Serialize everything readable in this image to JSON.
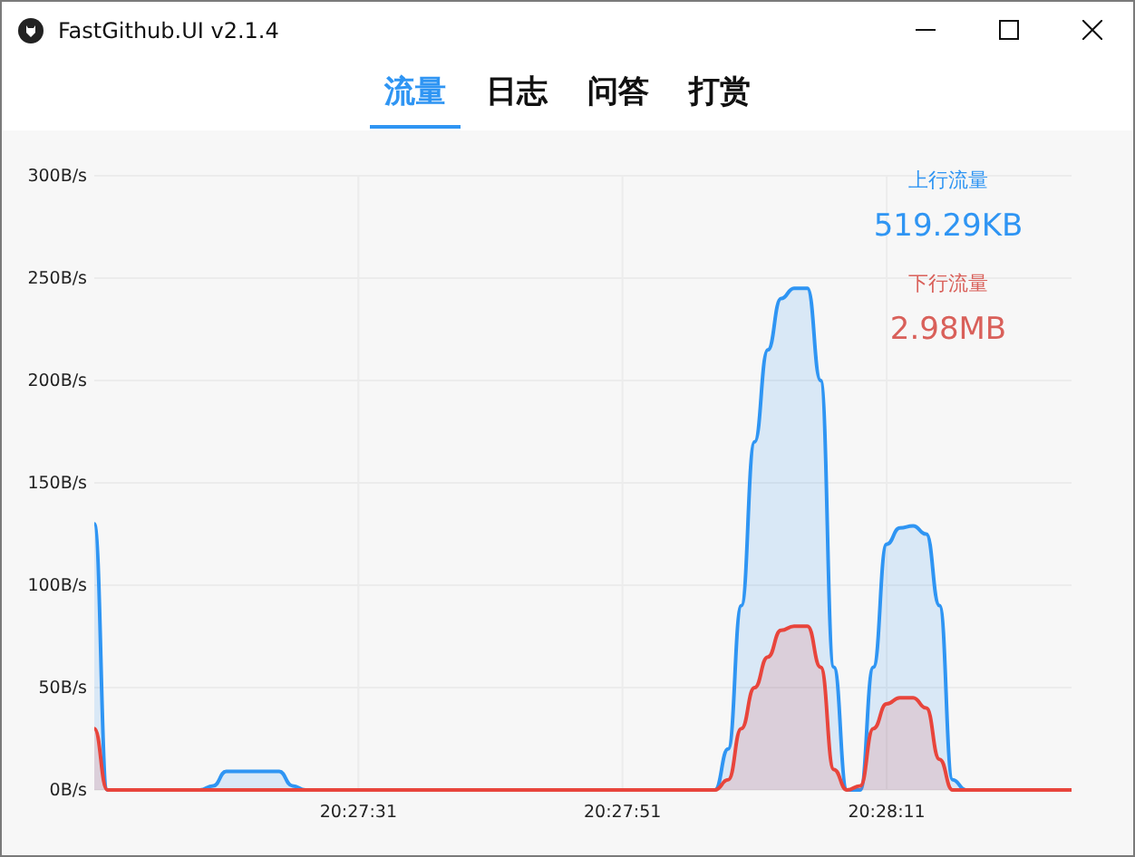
{
  "window": {
    "title": "FastGithub.UI v2.1.4"
  },
  "tabs": [
    {
      "label": "流量",
      "selected": true
    },
    {
      "label": "日志",
      "selected": false
    },
    {
      "label": "问答",
      "selected": false
    },
    {
      "label": "打赏",
      "selected": false
    }
  ],
  "stats": [
    {
      "label": "上行流量",
      "value": "519.29KB",
      "color": "#2f95f3"
    },
    {
      "label": "下行流量",
      "value": "2.98MB",
      "color": "#d9605a"
    }
  ],
  "chart_data": {
    "type": "area",
    "categories": [
      null,
      null,
      null,
      null,
      null,
      null,
      null,
      null,
      null,
      null,
      null,
      null,
      null,
      null,
      null,
      null,
      null,
      null,
      null,
      null,
      "20:27:31",
      null,
      null,
      null,
      null,
      null,
      null,
      null,
      null,
      null,
      null,
      null,
      null,
      null,
      null,
      null,
      null,
      null,
      null,
      null,
      "20:27:51",
      null,
      null,
      null,
      null,
      null,
      null,
      null,
      null,
      null,
      null,
      null,
      null,
      null,
      null,
      null,
      null,
      null,
      null,
      null,
      "20:28:11",
      null,
      null,
      null,
      null,
      null,
      null,
      null,
      null,
      null,
      null,
      null,
      null,
      null,
      null
    ],
    "series": [
      {
        "color": "#2f95f3",
        "values": [
          130,
          0,
          0,
          0,
          0,
          0,
          0,
          0,
          0,
          2,
          9,
          9,
          9,
          9,
          9,
          2,
          0,
          0,
          0,
          0,
          0,
          0,
          0,
          0,
          0,
          0,
          0,
          0,
          0,
          0,
          0,
          0,
          0,
          0,
          0,
          0,
          0,
          0,
          0,
          0,
          0,
          0,
          0,
          0,
          0,
          0,
          0,
          0,
          20,
          90,
          170,
          215,
          240,
          245,
          245,
          200,
          60,
          0,
          0,
          60,
          120,
          128,
          129,
          125,
          90,
          5,
          0,
          0,
          0,
          0,
          0,
          0,
          0,
          0,
          0
        ]
      },
      {
        "color": "#e8453c",
        "values": [
          30,
          0,
          0,
          0,
          0,
          0,
          0,
          0,
          0,
          0,
          0,
          0,
          0,
          0,
          0,
          0,
          0,
          0,
          0,
          0,
          0,
          0,
          0,
          0,
          0,
          0,
          0,
          0,
          0,
          0,
          0,
          0,
          0,
          0,
          0,
          0,
          0,
          0,
          0,
          0,
          0,
          0,
          0,
          0,
          0,
          0,
          0,
          0,
          5,
          30,
          50,
          65,
          78,
          80,
          80,
          60,
          10,
          0,
          2,
          30,
          42,
          45,
          45,
          40,
          15,
          0,
          0,
          0,
          0,
          0,
          0,
          0,
          0,
          0,
          0
        ]
      }
    ],
    "ylim": [
      0,
      300
    ],
    "grid": true,
    "yticks": [
      {
        "value": 0,
        "label": "0B/s"
      },
      {
        "value": 50,
        "label": "50B/s"
      },
      {
        "value": 100,
        "label": "100B/s"
      },
      {
        "value": 150,
        "label": "150B/s"
      },
      {
        "value": 200,
        "label": "200B/s"
      },
      {
        "value": 250,
        "label": "250B/s"
      },
      {
        "value": 300,
        "label": "300B/s"
      }
    ]
  }
}
